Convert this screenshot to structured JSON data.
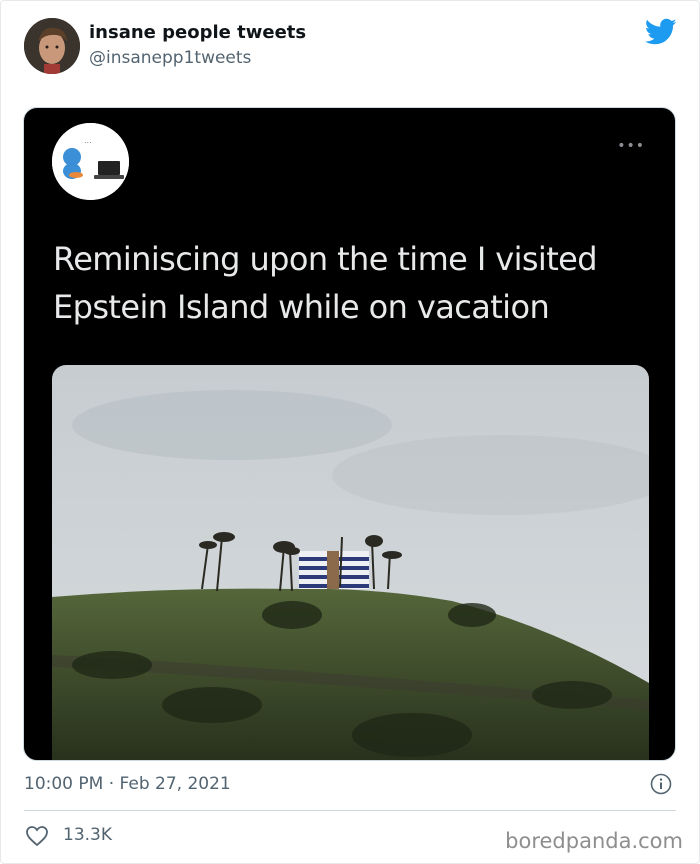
{
  "tweet": {
    "author_name": "insane people tweets",
    "author_handle": "@insanepp1tweets",
    "embedded": {
      "more_label": "•••",
      "text": "Reminiscing upon the time I visited Epstein Island while on vacation"
    },
    "timestamp": "10:00 PM · Feb 27, 2021",
    "likes": "13.3K"
  },
  "watermark": "boredpanda.com",
  "colors": {
    "twitter_blue": "#1d9bf0",
    "secondary_text": "#536471",
    "embed_background": "#000000"
  },
  "icons": [
    "twitter-bird-icon",
    "info-icon",
    "heart-icon",
    "more-icon"
  ]
}
